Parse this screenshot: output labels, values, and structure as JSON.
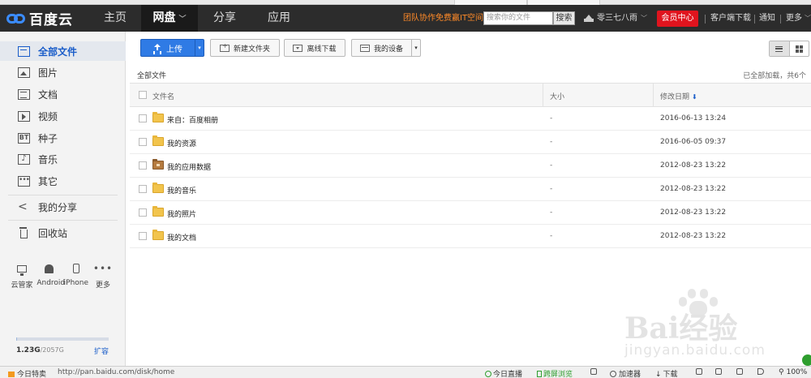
{
  "app": {
    "logo_text": "百度云"
  },
  "nav": {
    "items": [
      {
        "label": "主页",
        "active": false
      },
      {
        "label": "网盘",
        "active": true,
        "caret": "﹀"
      },
      {
        "label": "分享",
        "active": false
      },
      {
        "label": "应用",
        "active": false
      }
    ],
    "promo": "团队协作免费赢IT空间",
    "search_placeholder": "搜索你的文件",
    "search_button": "搜索",
    "username": "零三七八雨",
    "user_caret": "﹀",
    "vip_button": "会员中心",
    "client_download": "客户端下载",
    "notifications": "通知",
    "more": "更多",
    "more_caret": "﹀"
  },
  "sidebar": {
    "items": [
      {
        "label": "全部文件",
        "icon": "home-folder-icon",
        "active": true
      },
      {
        "label": "图片",
        "icon": "image-icon"
      },
      {
        "label": "文档",
        "icon": "document-icon"
      },
      {
        "label": "视频",
        "icon": "video-icon"
      },
      {
        "label": "种子",
        "icon": "bt-icon",
        "glyph": "BT"
      },
      {
        "label": "音乐",
        "icon": "music-icon",
        "glyph": "♪"
      },
      {
        "label": "其它",
        "icon": "other-icon",
        "glyph": "•••"
      }
    ],
    "share": {
      "label": "我的分享",
      "glyph": "<"
    },
    "trash": {
      "label": "回收站"
    },
    "devices": [
      {
        "label": "云管家",
        "icon": "monitor-icon"
      },
      {
        "label": "Android",
        "icon": "android-icon"
      },
      {
        "label": "iPhone",
        "icon": "iphone-icon"
      },
      {
        "label": "更多",
        "icon": "more-dots-icon",
        "glyph": "•••"
      }
    ],
    "quota": {
      "used": "1.23G",
      "total": "/2057G",
      "used_fraction": 0.001
    },
    "expand": "扩容"
  },
  "toolbar": {
    "upload": "上传",
    "upload_caret": "▾",
    "new_folder": "新建文件夹",
    "offline_download": "离线下载",
    "my_devices": "我的设备",
    "devices_caret": "▾"
  },
  "breadcrumb": {
    "path": "全部文件",
    "status": "已全部加载，共6个"
  },
  "table": {
    "headers": {
      "name": "文件名",
      "size": "大小",
      "date": "修改日期",
      "sort_indicator": "⬇"
    },
    "rows": [
      {
        "name": "来自：百度相册",
        "size": "-",
        "date": "2016-06-13 13:24",
        "icon": "folder"
      },
      {
        "name": "我的资源",
        "size": "-",
        "date": "2016-06-05 09:37",
        "icon": "folder"
      },
      {
        "name": "我的应用数据",
        "size": "-",
        "date": "2012-08-23 13:22",
        "icon": "app-folder"
      },
      {
        "name": "我的音乐",
        "size": "-",
        "date": "2012-08-23 13:22",
        "icon": "folder"
      },
      {
        "name": "我的照片",
        "size": "-",
        "date": "2012-08-23 13:22",
        "icon": "folder"
      },
      {
        "name": "我的文档",
        "size": "-",
        "date": "2012-08-23 13:22",
        "icon": "folder"
      }
    ]
  },
  "watermark": {
    "brand": "Bai经验",
    "url": "jingyan.baidu.com"
  },
  "statusbar": {
    "today_deals": "今日特卖",
    "url": "http://pan.baidu.com/disk/home",
    "today_live": "今日直播",
    "cross_screen": "跨屏浏览",
    "accelerator": "加速器",
    "downloads": "下载",
    "zoom": "100%"
  },
  "colors": {
    "accent": "#2f7be5",
    "vip": "#e0141e",
    "navbar": "#2c2c2c",
    "promo": "#ff8a28"
  }
}
